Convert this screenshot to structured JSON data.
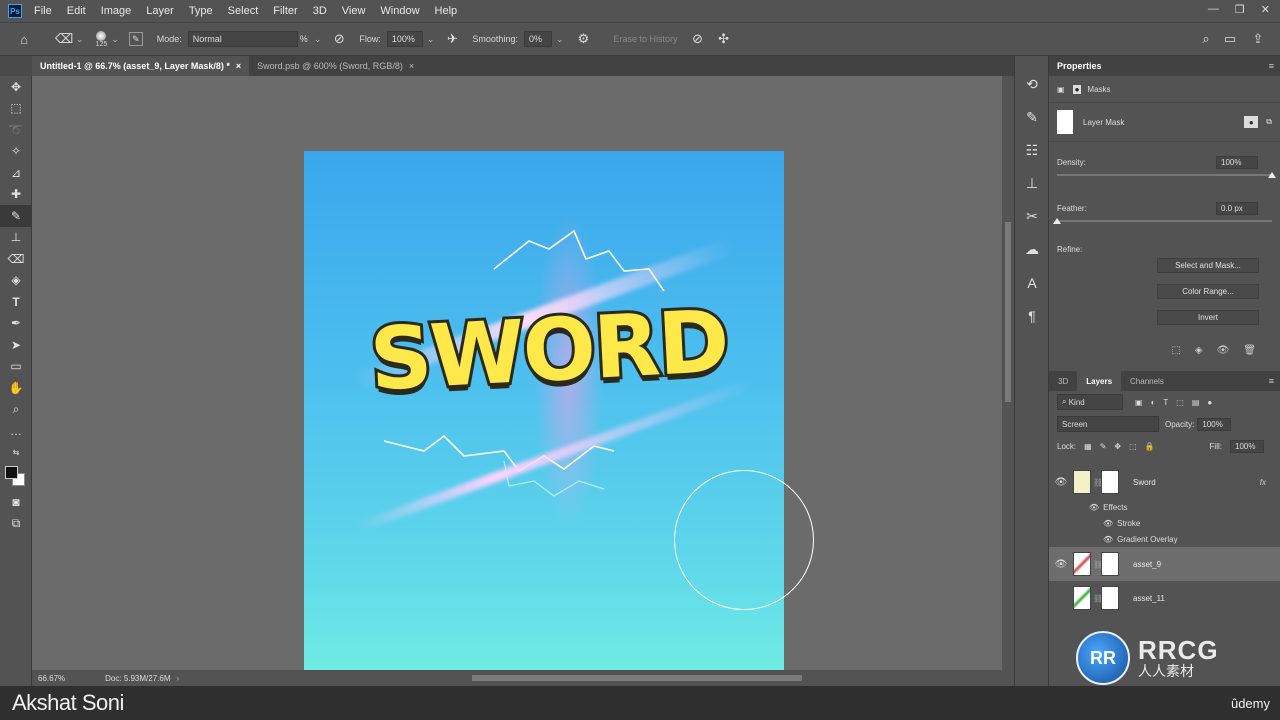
{
  "app": {
    "logo": "Ps"
  },
  "menu": [
    "File",
    "Edit",
    "Image",
    "Layer",
    "Type",
    "Select",
    "Filter",
    "3D",
    "View",
    "Window",
    "Help"
  ],
  "window_controls": [
    "—",
    "❐",
    "✕"
  ],
  "options": {
    "brush_size": "125",
    "mode_label": "Mode:",
    "mode_value": "Normal",
    "opacity_fraction_text": "%",
    "flow_label": "Flow:",
    "flow_value": "100%",
    "smoothing_label": "Smoothing:",
    "smoothing_value": "0%",
    "erase_history": "Erase to History"
  },
  "tabs": [
    {
      "label": "Untitled-1 @ 66.7% (asset_9, Layer Mask/8) *",
      "close": "×"
    },
    {
      "label": "Sword.psb @ 600% (Sword, RGB/8)",
      "close": "×"
    }
  ],
  "canvas": {
    "title_text": "SWORD",
    "colors": {
      "bg_top": "#3aa7ec",
      "bg_bottom": "#70ece4",
      "text_fill": "#ffe84a",
      "text_stroke": "#2a2a1a"
    }
  },
  "status": {
    "zoom": "66.67%",
    "doc": "Doc: 5.93M/27.6M"
  },
  "properties": {
    "title": "Properties",
    "masks_label": "Masks",
    "layer_mask_label": "Layer Mask",
    "density_label": "Density:",
    "density_value": "100%",
    "feather_label": "Feather:",
    "feather_value": "0.0 px",
    "refine_label": "Refine:",
    "select_and_mask": "Select and Mask...",
    "color_range": "Color Range...",
    "invert": "Invert"
  },
  "layers_panel": {
    "tabs": [
      "3D",
      "Layers",
      "Channels"
    ],
    "kind_label": "Kind",
    "blend_mode": "Screen",
    "opacity_label": "Opacity:",
    "opacity_value": "100%",
    "lock_label": "Lock:",
    "fill_label": "Fill:",
    "fill_value": "100%",
    "layers": [
      {
        "name": "Sword",
        "fx": "fx",
        "visible": true
      },
      {
        "name": "asset_9",
        "visible": true
      },
      {
        "name": "asset_11",
        "visible": false
      }
    ],
    "effects_label": "Effects",
    "effects": [
      "Stroke",
      "Gradient Overlay"
    ]
  },
  "footer": {
    "author": "Akshat Soni",
    "brand": "ûdemy"
  },
  "watermark": {
    "badge": "RR",
    "big": "RRCG",
    "small": "人人素材"
  }
}
